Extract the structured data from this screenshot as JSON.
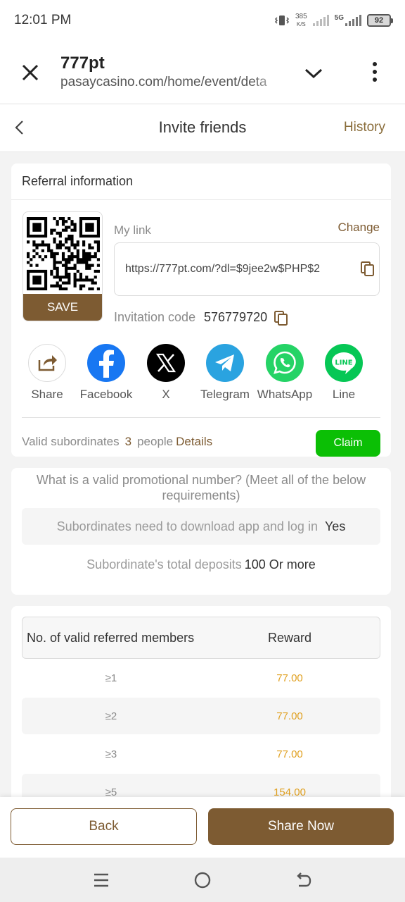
{
  "status_bar": {
    "time": "12:01 PM",
    "net_speed_value": "385",
    "net_speed_unit": "K/S",
    "network": "5G",
    "battery": "92"
  },
  "browser": {
    "title": "777pt",
    "url": "pasaycasino.com/home/event/deta"
  },
  "header": {
    "title": "Invite friends",
    "history": "History"
  },
  "referral": {
    "section_title": "Referral information",
    "save_label": "SAVE",
    "my_link_label": "My link",
    "change_label": "Change",
    "link": "https://777pt.com/?dl=$9jee2w$PHP$2",
    "invitation_code_label": "Invitation code",
    "invitation_code": "576779720",
    "share_options": [
      {
        "label": "Share",
        "icon": "share-icon"
      },
      {
        "label": "Facebook",
        "icon": "facebook-icon"
      },
      {
        "label": "X",
        "icon": "x-icon"
      },
      {
        "label": "Telegram",
        "icon": "telegram-icon"
      },
      {
        "label": "WhatsApp",
        "icon": "whatsapp-icon"
      },
      {
        "label": "Line",
        "icon": "line-icon"
      }
    ],
    "valid_subordinates_label": "Valid subordinates",
    "valid_subordinates_count": "3",
    "people_label": "people",
    "details_label": "Details",
    "claim_label": "Claim"
  },
  "requirements": {
    "title": "What is a valid promotional number? (Meet all of the below requirements)",
    "rows": [
      {
        "label": "Subordinates need to download app and log in",
        "value": "Yes"
      },
      {
        "label": "Subordinate's total deposits",
        "value": "100 Or more"
      }
    ]
  },
  "rewards": {
    "col_members": "No. of valid referred members",
    "col_reward": "Reward",
    "rows": [
      {
        "members": "≥1",
        "reward": "77.00"
      },
      {
        "members": "≥2",
        "reward": "77.00"
      },
      {
        "members": "≥3",
        "reward": "77.00"
      },
      {
        "members": "≥5",
        "reward": "154.00"
      }
    ]
  },
  "actions": {
    "back": "Back",
    "share_now": "Share Now"
  },
  "colors": {
    "brand_brown": "#7d5b32",
    "claim_green": "#0bbf05",
    "reward_gold": "#e0a020"
  }
}
